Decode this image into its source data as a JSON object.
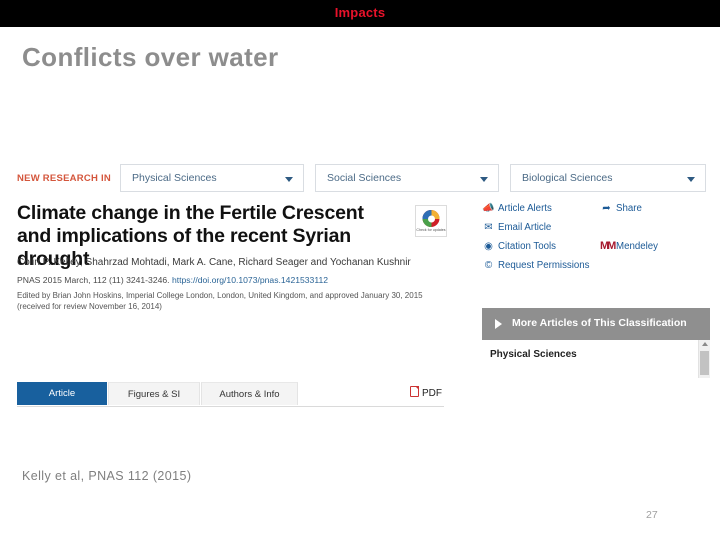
{
  "slide": {
    "banner_label": "Impacts",
    "banner_bg": "#000000",
    "banner_color": "#e8122a",
    "title": "Conflicts over water",
    "title_color": "#8d8d8d",
    "caption": "Kelly et al, PNAS 112 (2015)",
    "page_number": "27"
  },
  "screenshot": {
    "new_research": {
      "label": "NEW RESEARCH IN",
      "label_color": "#d4563c",
      "selects": [
        {
          "name": "physical-sciences",
          "value": "Physical Sciences"
        },
        {
          "name": "social-sciences",
          "value": "Social Sciences"
        },
        {
          "name": "biological-sciences",
          "value": "Biological Sciences"
        }
      ]
    },
    "article": {
      "title": "Climate change in the Fertile Crescent and implications of the recent Syrian drought",
      "authors": "Colin P. Kelley, Shahrzad Mohtadi, Mark A. Cane, Richard Seager and Yochanan Kushnir",
      "citation_prefix": "PNAS 2015 March, 112 (11) 3241-3246. ",
      "doi": "https://doi.org/10.1073/pnas.1421533112",
      "edited_line1": "Edited by Brian John Hoskins, Imperial College London, London, United Kingdom, and approved January 30, 2015",
      "edited_line2": "(received for review November 16, 2014)",
      "crossmark_caption": "Check for updates",
      "tabs": [
        {
          "label": "Article",
          "active": true
        },
        {
          "label": "Figures & SI",
          "active": false
        },
        {
          "label": "Authors & Info",
          "active": false
        }
      ],
      "pdf_label": "PDF",
      "active_tab_color": "#18609e"
    },
    "actions": [
      {
        "icon": "megaphone-icon",
        "glyph": "📣",
        "label": "Article Alerts"
      },
      {
        "icon": "envelope-icon",
        "glyph": "✉",
        "label": "Email Article"
      },
      {
        "icon": "globe-icon",
        "glyph": "◉",
        "label": "Citation Tools"
      },
      {
        "icon": "copyright-icon",
        "glyph": "©",
        "label": "Request Permissions"
      },
      {
        "icon": "share-icon",
        "glyph": "➦",
        "label": "Share"
      },
      {
        "icon": "mendeley-icon",
        "glyph": "MM",
        "label": "Mendeley"
      }
    ],
    "more_articles": {
      "header": "More Articles of This Classification",
      "header_bg": "#8f8f8f",
      "category": "Physical Sciences"
    }
  }
}
